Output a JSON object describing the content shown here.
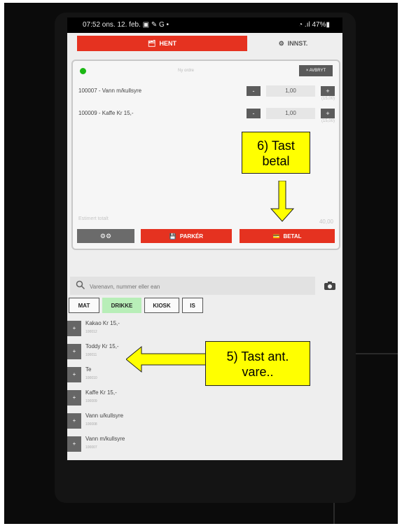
{
  "statusbar": {
    "time": "07:52  ons. 12. feb.  ▣ ✎ G •",
    "battery": "47%"
  },
  "tabs": {
    "hent": "HENT",
    "innst": "INNST."
  },
  "order": {
    "status": "Ny ordre",
    "cancel": "× AVBRYT",
    "lines": [
      {
        "name": "100007 - Vann m/kullsyre",
        "minus": "-",
        "qty": "1,00",
        "plus": "+",
        "price": "(15,00)"
      },
      {
        "name": "100009 - Kaffe Kr 15,-",
        "minus": "-",
        "qty": "1,00",
        "plus": "+",
        "price": "(15,00)"
      }
    ],
    "estimated_label": "Estimert totalt",
    "estimated_value": "40,00",
    "parker_label": "PARKÉR",
    "betal_label": "BETAL"
  },
  "search": {
    "placeholder": "Varenavn, nummer eller ean"
  },
  "categories": [
    "MAT",
    "DRIKKE",
    "KIOSK",
    "IS"
  ],
  "products": [
    {
      "name": "Kakao Kr 15,-",
      "number": "100012"
    },
    {
      "name": "Toddy Kr 15,-",
      "number": "100011"
    },
    {
      "name": "Te",
      "number": "100010"
    },
    {
      "name": "Kaffe Kr 15,-",
      "number": "100009"
    },
    {
      "name": "Vann u/kullsyre",
      "number": "100008"
    },
    {
      "name": "Vann m/kullsyre",
      "number": "100007"
    }
  ],
  "product_button": "+",
  "annotations": {
    "step6_line1": "6) Tast",
    "step6_line2": "betal",
    "step5_line1": "5) Tast ant.",
    "step5_line2": "vare.."
  },
  "colors": {
    "accent": "#e53220",
    "callout": "#ffff00",
    "active_category": "#b8eeb8",
    "status_dot": "#1bb814"
  }
}
